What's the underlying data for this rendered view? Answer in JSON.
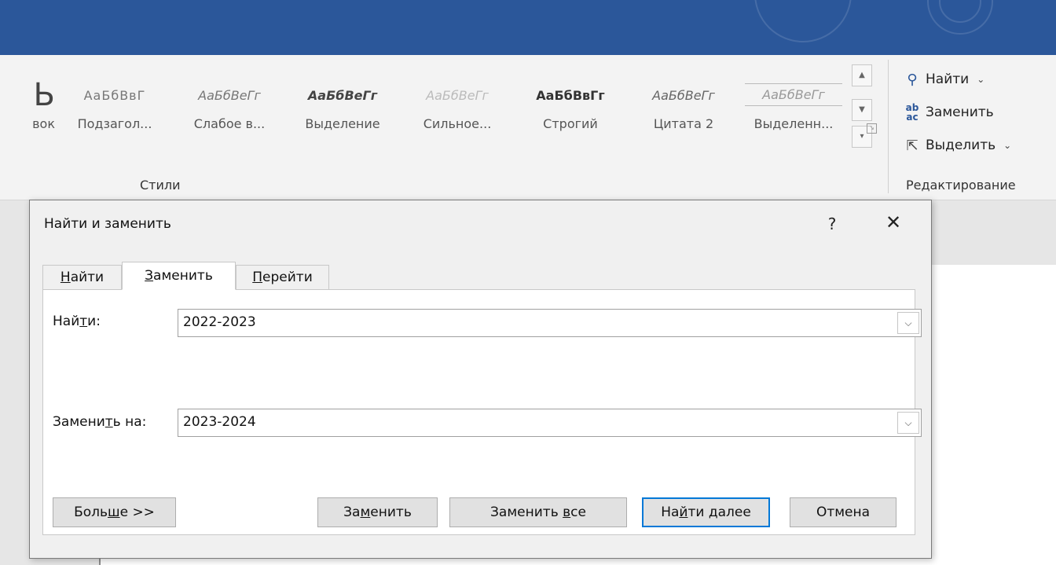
{
  "ribbon": {
    "styles": [
      {
        "sample": "Ь",
        "name": "вок"
      },
      {
        "sample": "АаБбВвГ",
        "name": "Подзагол..."
      },
      {
        "sample": "АаБбВеГг",
        "name": "Слабое в..."
      },
      {
        "sample": "АаБбВеГг",
        "name": "Выделение"
      },
      {
        "sample": "АаБбВеГг",
        "name": "Сильное..."
      },
      {
        "sample": "АаБбВвГг",
        "name": "Строгий"
      },
      {
        "sample": "АаБбВеГг",
        "name": "Цитата 2"
      },
      {
        "sample": "АаБбВеГг",
        "name": "Выделенн..."
      }
    ],
    "styles_group_label": "Стили",
    "editing": {
      "find_label": "Найти",
      "replace_label": "Заменить",
      "select_label": "Выделить",
      "group_label": "Редактирование"
    }
  },
  "dialog": {
    "title": "Найти и заменить",
    "help": "?",
    "close": "✕",
    "tabs": [
      {
        "pre": "",
        "key": "Н",
        "post": "айти"
      },
      {
        "pre": "",
        "key": "З",
        "post": "аменить"
      },
      {
        "pre": "",
        "key": "П",
        "post": "ерейти"
      }
    ],
    "find_label": {
      "pre": "Най",
      "key": "т",
      "post": "и:"
    },
    "find_value": "2022-2023",
    "replace_label": {
      "pre": "Замени",
      "key": "т",
      "post": "ь на:"
    },
    "replace_value": "2023-2024",
    "buttons": {
      "more": {
        "pre": "Боль",
        "key": "ш",
        "post": "е >>"
      },
      "replace": {
        "pre": "За",
        "key": "м",
        "post": "енить"
      },
      "replace_all": {
        "pre": "Заменить ",
        "key": "в",
        "post": "се"
      },
      "find_next": {
        "pre": "На",
        "key": "й",
        "post": "ти далее"
      },
      "cancel": {
        "pre": "Отмена",
        "key": "",
        "post": ""
      }
    }
  },
  "colors": {
    "titlebar": "#2b579a",
    "accent_default_button": "#0078d7"
  },
  "icons": {
    "find": "search-icon",
    "replace": "replace-icon",
    "select": "cursor-select-icon",
    "combo_arrow": "chevron-down-icon"
  }
}
